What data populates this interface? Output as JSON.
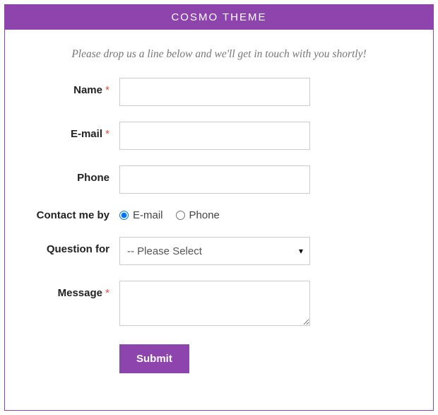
{
  "header": {
    "title": "COSMO THEME"
  },
  "intro": "Please drop us a line below and we'll get in touch with you shortly!",
  "form": {
    "name": {
      "label": "Name",
      "required": true,
      "value": ""
    },
    "email": {
      "label": "E-mail",
      "required": true,
      "value": ""
    },
    "phone": {
      "label": "Phone",
      "required": false,
      "value": ""
    },
    "contact_by": {
      "label": "Contact me by",
      "options": [
        {
          "label": "E-mail",
          "value": "email",
          "selected": true
        },
        {
          "label": "Phone",
          "value": "phone",
          "selected": false
        }
      ]
    },
    "question_for": {
      "label": "Question for",
      "selected_label": "-- Please Select"
    },
    "message": {
      "label": "Message",
      "required": true,
      "value": ""
    },
    "submit_label": "Submit"
  },
  "required_marker": "*",
  "colors": {
    "accent": "#8e44ad",
    "required": "#e74c3c"
  }
}
